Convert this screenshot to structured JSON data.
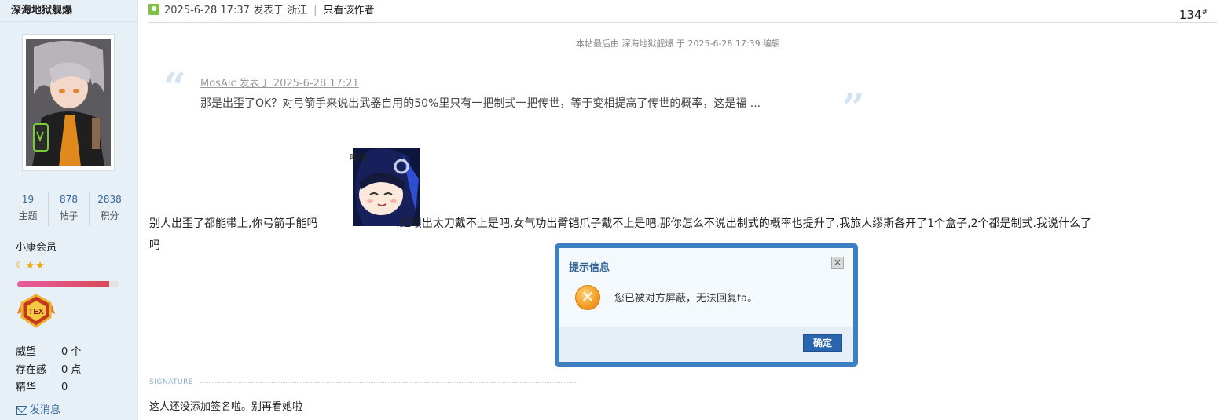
{
  "user": {
    "name": "深海地狱舰爆",
    "stats": [
      {
        "value": "19",
        "label": "主题"
      },
      {
        "value": "878",
        "label": "帖子"
      },
      {
        "value": "2838",
        "label": "积分"
      }
    ],
    "group": "小康会员",
    "stars": "☾★★",
    "level_progress": 0.9,
    "medal_text": "TEX",
    "fields": [
      {
        "key": "威望",
        "value": "0 个"
      },
      {
        "key": "存在感",
        "value": "0 点"
      },
      {
        "key": "精华",
        "value": "0"
      }
    ],
    "send_message": "发消息"
  },
  "post": {
    "meta": "2025-6-28 17:37 发表于 浙江",
    "only_author": "只看该作者",
    "floor": "134",
    "floor_sup": "#",
    "edit_note": "本帖最后由 深海地狱舰爆 于 2025-6-28 17:39 编辑",
    "quote_meta": "MosAic 发表于 2025-6-28 17:21",
    "quote_text": "那是出歪了OK？对弓箭手来说出武器自用的50%里只有一把制式一把传世，等于变相提高了传世的概率，这是福 ...",
    "sticker_caption": "嘻嘻",
    "body_part1": "别人出歪了都能带上,你弓箭手能吗",
    "body_part2": ",红眼出太刀戴不上是吧,女气功出臂铠爪子戴不上是吧.那你怎么不说出制式的概率也提升了.我旅人缪斯各开了1个盒子,2个都是制式.我说什么了",
    "body_part3": "吗",
    "signature_label": "SIGNATURE",
    "signature": "这人还没添加签名啦。别再看她啦"
  },
  "dialog": {
    "title": "提示信息",
    "close": "×",
    "message": "您已被对方屏蔽，无法回复ta。",
    "ok_label": "确定"
  },
  "colors": {
    "sidebar_bg": "#e8f0f7",
    "dialog_border": "#3d7fc0",
    "ok_button": "#2a66b0",
    "link_blue": "#336699"
  }
}
